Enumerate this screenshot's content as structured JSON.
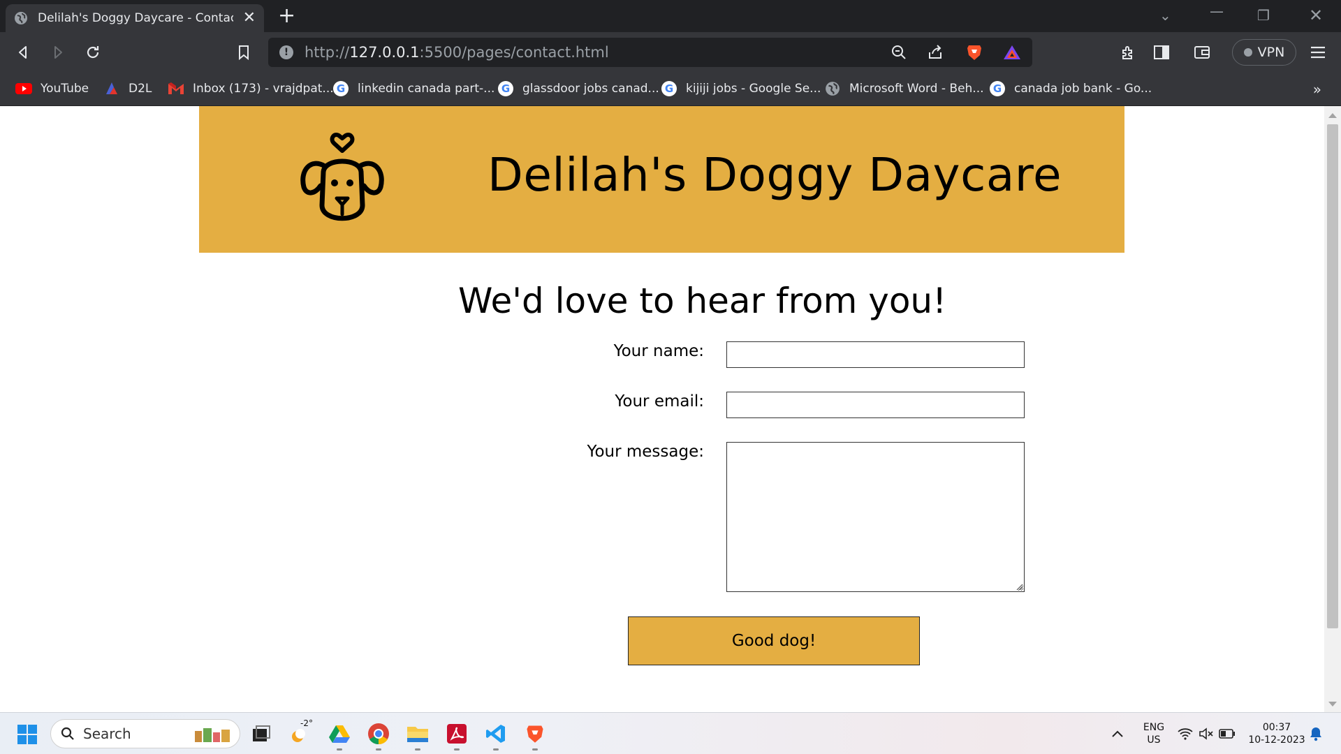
{
  "browser": {
    "tab_title": "Delilah's Doggy Daycare - Contact Us",
    "url_prefix": "http://",
    "url_host": "127.0.0.1",
    "url_rest": ":5500/pages/contact.html",
    "vpn_label": "VPN",
    "new_tab_symbol": "+",
    "close_symbol": "✕",
    "bookmarks": [
      {
        "label": "YouTube",
        "icon": "youtube-icon"
      },
      {
        "label": "D2L",
        "icon": "d2l-icon"
      },
      {
        "label": "Inbox (173) - vrajdpat...",
        "icon": "gmail-icon"
      },
      {
        "label": "linkedin canada part-...",
        "icon": "google-icon"
      },
      {
        "label": "glassdoor jobs canad...",
        "icon": "google-icon"
      },
      {
        "label": "kijiji jobs - Google Se...",
        "icon": "google-icon"
      },
      {
        "label": "Microsoft Word - Beh...",
        "icon": "globe-icon"
      },
      {
        "label": "canada job bank - Go...",
        "icon": "google-icon"
      }
    ],
    "more_bookmarks": "»"
  },
  "page": {
    "site_title": "Delilah's Doggy Daycare",
    "heading": "We'd love to hear from you!",
    "form": {
      "name_label": "Your name:",
      "name_value": "",
      "email_label": "Your email:",
      "email_value": "",
      "message_label": "Your message:",
      "message_value": "",
      "submit_label": "Good dog!"
    }
  },
  "taskbar": {
    "search_label": "Search",
    "weather_temp": "-2°",
    "language": "ENG",
    "region": "US",
    "time": "00:37",
    "date": "10-12-2023",
    "apps": [
      "task-view-icon",
      "weather-icon",
      "google-drive-icon",
      "chrome-icon",
      "file-explorer-icon",
      "acrobat-icon",
      "vscode-icon",
      "brave-icon"
    ]
  },
  "colors": {
    "header_gold": "#e4ae42",
    "browser_dark": "#35363a",
    "browser_darker": "#202124"
  }
}
